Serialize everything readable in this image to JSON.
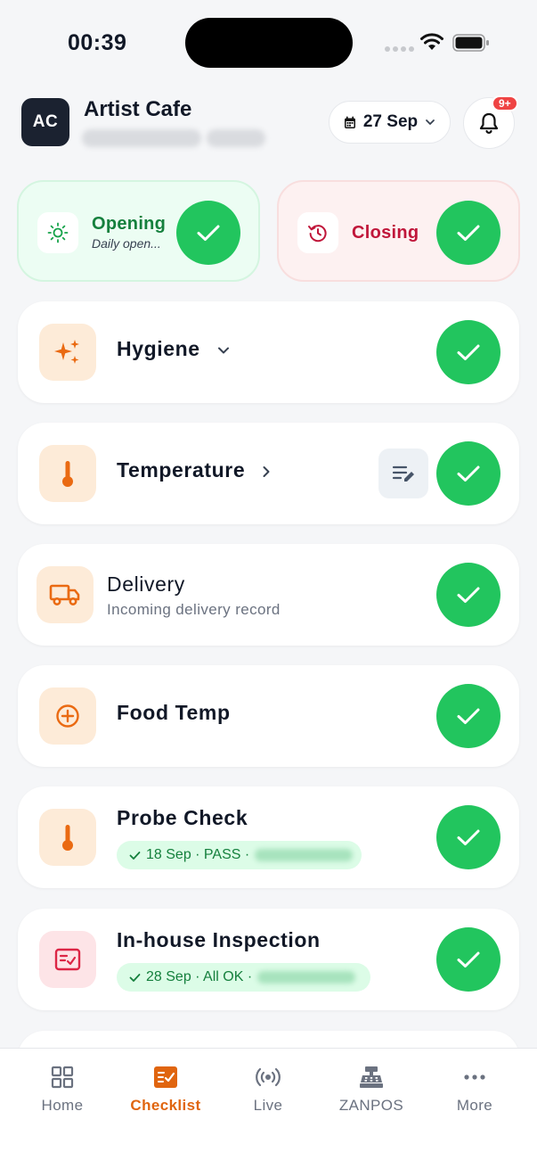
{
  "status_bar": {
    "time": "00:39"
  },
  "header": {
    "avatar_initials": "AC",
    "cafe_name": "Artist Cafe",
    "date_label": "27 Sep",
    "notification_badge": "9+"
  },
  "top_cards": {
    "opening": {
      "title": "Opening",
      "subtitle": "Daily open..."
    },
    "closing": {
      "title": "Closing"
    }
  },
  "checklist": {
    "hygiene": {
      "title": "Hygiene"
    },
    "temperature": {
      "title": "Temperature"
    },
    "delivery": {
      "title": "Delivery",
      "subtitle": "Incoming delivery record"
    },
    "food_temp": {
      "title": "Food Temp"
    },
    "probe_check": {
      "title": "Probe Check",
      "status": "18 Sep · PASS ·"
    },
    "inspection": {
      "title": "In-house Inspection",
      "status": "28 Sep · All OK ·"
    }
  },
  "nav": {
    "home": "Home",
    "checklist": "Checklist",
    "live": "Live",
    "zanpos": "ZANPOS",
    "more": "More"
  },
  "colors": {
    "accent_orange": "#e0650f",
    "success_green": "#22c55e",
    "closing_red": "#c0163a"
  }
}
